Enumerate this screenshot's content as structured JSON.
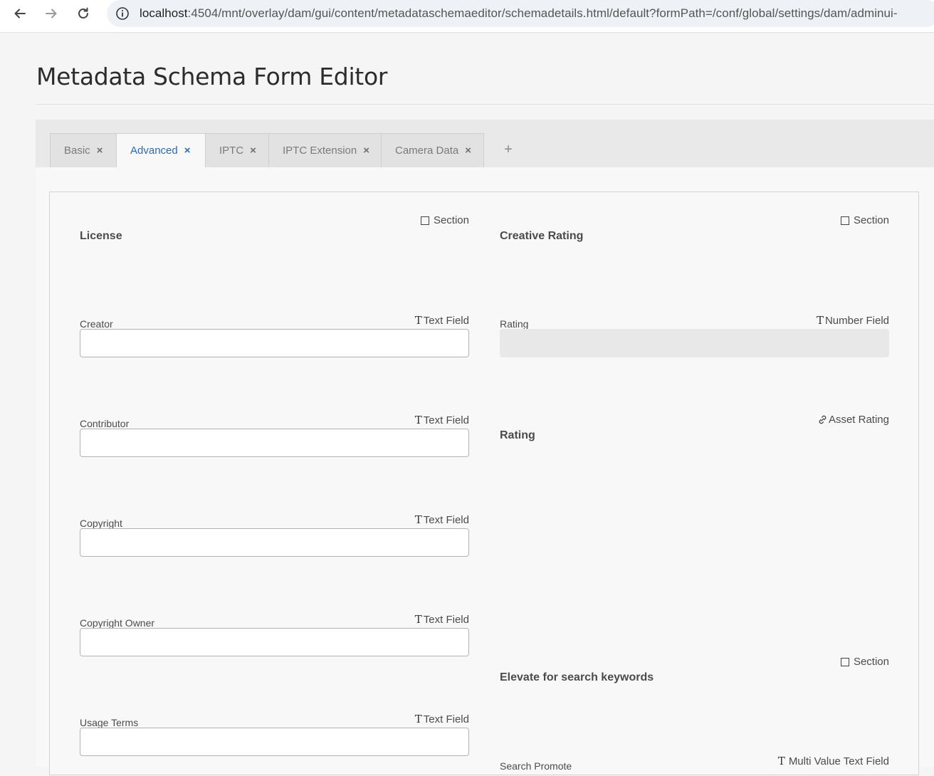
{
  "browser": {
    "url_host": "localhost",
    "url_path": ":4504/mnt/overlay/dam/gui/content/metadataschemaeditor/schemadetails.html/default?formPath=/conf/global/settings/dam/adminui-"
  },
  "page": {
    "title": "Metadata Schema Form Editor"
  },
  "tabs": [
    {
      "label": "Basic",
      "close": "×"
    },
    {
      "label": "Advanced",
      "close": "×"
    },
    {
      "label": "IPTC",
      "close": "×"
    },
    {
      "label": "IPTC Extension",
      "close": "×"
    },
    {
      "label": "Camera Data",
      "close": "×"
    }
  ],
  "add_tab": "+",
  "left_column": {
    "section": {
      "heading": "License",
      "type": "Section"
    },
    "fields": [
      {
        "label": "Creator",
        "type": "Text Field",
        "value": ""
      },
      {
        "label": "Contributor",
        "type": "Text Field",
        "value": ""
      },
      {
        "label": "Copyright",
        "type": "Text Field",
        "value": ""
      },
      {
        "label": "Copyright Owner",
        "type": "Text Field",
        "value": ""
      },
      {
        "label": "Usage Terms",
        "type": "Text Field",
        "value": ""
      }
    ]
  },
  "right_column": {
    "section1": {
      "heading": "Creative Rating",
      "type": "Section"
    },
    "rating_field": {
      "label": "Rating",
      "type": "Number Field",
      "value": ""
    },
    "asset_rating": {
      "heading": "Rating",
      "type": "Asset Rating"
    },
    "section2": {
      "heading": "Elevate for search keywords",
      "type": "Section"
    },
    "search_promote": {
      "label": "Search Promote",
      "type": "Multi Value Text Field"
    }
  },
  "icons": {
    "back": "arrow-left-icon",
    "forward": "arrow-right-icon",
    "reload": "reload-icon",
    "info": "info-icon",
    "text_type": "text-type-icon",
    "section_type": "checkbox-icon",
    "link_type": "link-icon"
  }
}
